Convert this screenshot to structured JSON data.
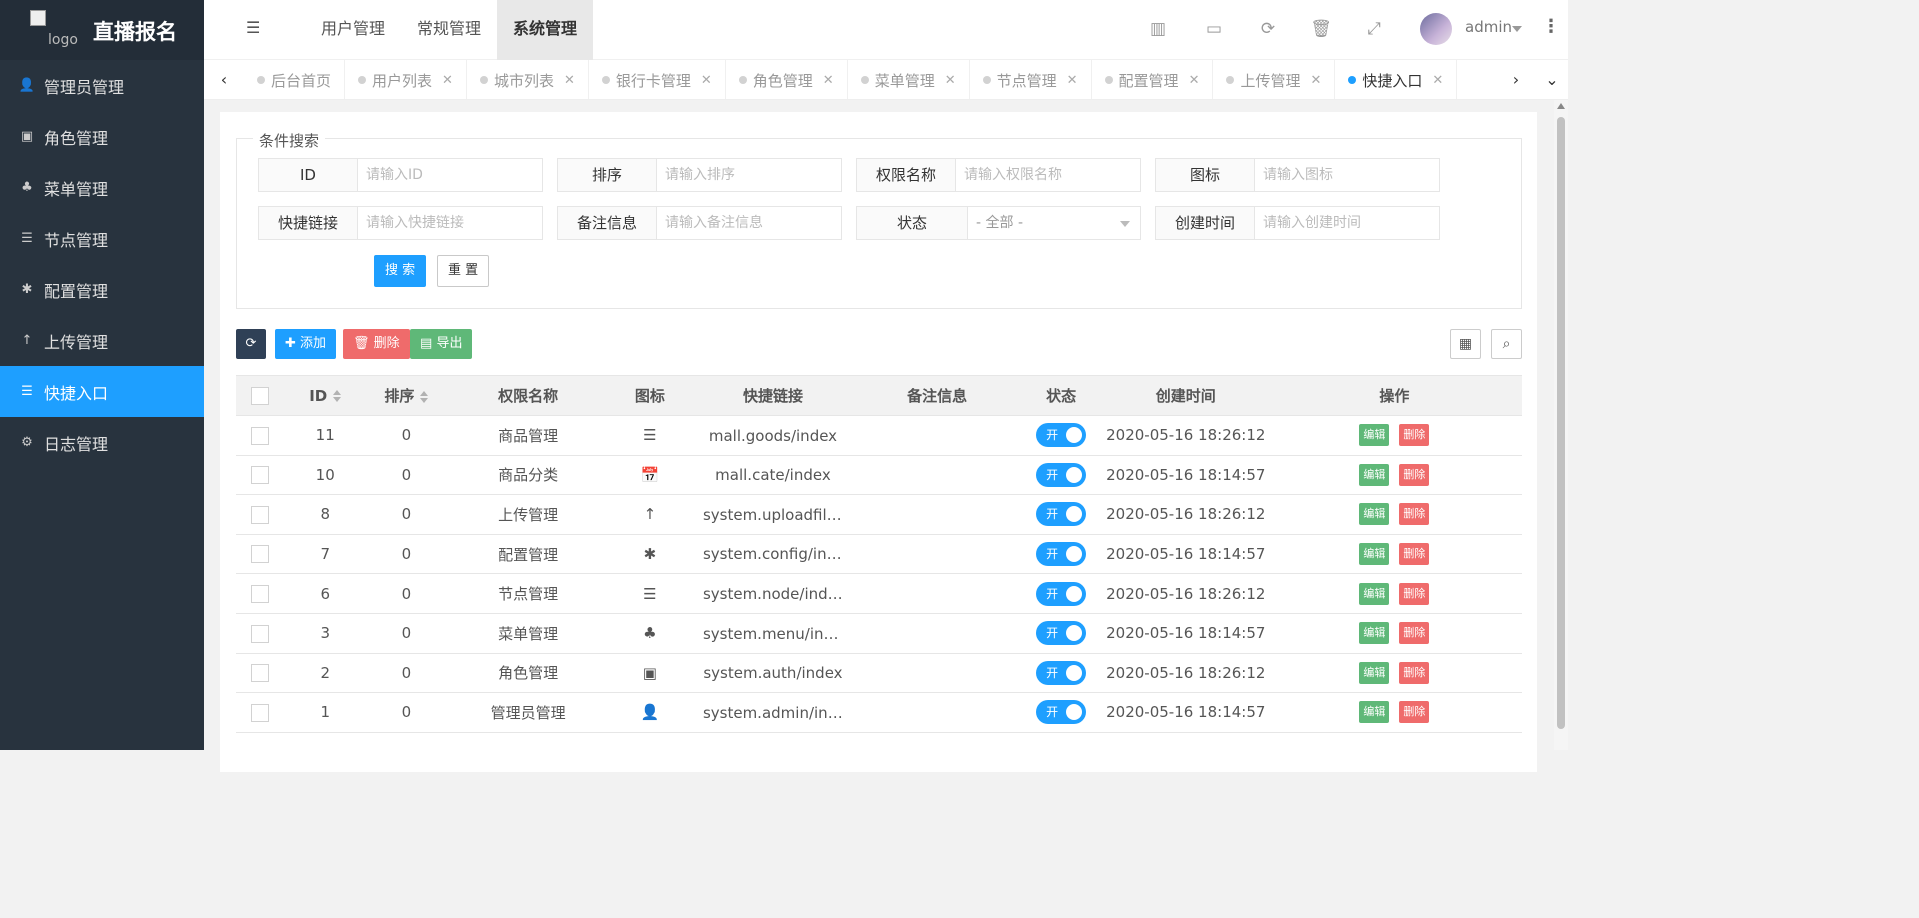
{
  "app": {
    "logo_alt": "logo",
    "title": "直播报名"
  },
  "sidebar": {
    "items": [
      {
        "label": "管理员管理",
        "icon": "user-icon",
        "glyph": "👤"
      },
      {
        "label": "角色管理",
        "icon": "id-badge-icon",
        "glyph": "▣"
      },
      {
        "label": "菜单管理",
        "icon": "tree-icon",
        "glyph": "♣"
      },
      {
        "label": "节点管理",
        "icon": "list-icon",
        "glyph": "☰"
      },
      {
        "label": "配置管理",
        "icon": "asterisk-icon",
        "glyph": "✱"
      },
      {
        "label": "上传管理",
        "icon": "arrow-up-icon",
        "glyph": "↑"
      },
      {
        "label": "快捷入口",
        "icon": "list-icon",
        "glyph": "☰"
      },
      {
        "label": "日志管理",
        "icon": "gear-icon",
        "glyph": "⚙"
      }
    ],
    "active_index": 6
  },
  "header": {
    "nav": [
      "用户管理",
      "常规管理",
      "系统管理"
    ],
    "active_nav": 2,
    "user": "admin"
  },
  "tabs": [
    {
      "label": "后台首页",
      "closable": false
    },
    {
      "label": "用户列表",
      "closable": true
    },
    {
      "label": "城市列表",
      "closable": true
    },
    {
      "label": "银行卡管理",
      "closable": true
    },
    {
      "label": "角色管理",
      "closable": true
    },
    {
      "label": "菜单管理",
      "closable": true
    },
    {
      "label": "节点管理",
      "closable": true
    },
    {
      "label": "配置管理",
      "closable": true
    },
    {
      "label": "上传管理",
      "closable": true
    },
    {
      "label": "快捷入口",
      "closable": true,
      "active": true
    }
  ],
  "search": {
    "legend": "条件搜索",
    "fields": [
      {
        "label": "ID",
        "placeholder": "请输入ID"
      },
      {
        "label": "排序",
        "placeholder": "请输入排序"
      },
      {
        "label": "权限名称",
        "placeholder": "请输入权限名称"
      },
      {
        "label": "图标",
        "placeholder": "请输入图标"
      },
      {
        "label": "快捷链接",
        "placeholder": "请输入快捷链接"
      },
      {
        "label": "备注信息",
        "placeholder": "请输入备注信息"
      },
      {
        "label": "状态",
        "select_value": "- 全部 -"
      },
      {
        "label": "创建时间",
        "placeholder": "请输入创建时间"
      }
    ],
    "search_btn": "搜 索",
    "reset_btn": "重 置"
  },
  "toolbar": {
    "add": "添加",
    "delete": "删除",
    "export": "导出"
  },
  "table": {
    "headers": [
      "ID",
      "排序",
      "权限名称",
      "图标",
      "快捷链接",
      "备注信息",
      "状态",
      "创建时间",
      "操作"
    ],
    "rows": [
      {
        "id": "11",
        "sort": "0",
        "name": "商品管理",
        "icon": "list-icon",
        "glyph": "☰",
        "link": "mall.goods/index",
        "remark": "",
        "status": "开",
        "created": "2020-05-16 18:26:12"
      },
      {
        "id": "10",
        "sort": "0",
        "name": "商品分类",
        "icon": "calendar-check-icon",
        "glyph": "📅",
        "link": "mall.cate/index",
        "remark": "",
        "status": "开",
        "created": "2020-05-16 18:14:57"
      },
      {
        "id": "8",
        "sort": "0",
        "name": "上传管理",
        "icon": "arrow-up-icon",
        "glyph": "↑",
        "link": "system.uploadfile/i…",
        "remark": "",
        "status": "开",
        "created": "2020-05-16 18:26:12"
      },
      {
        "id": "7",
        "sort": "0",
        "name": "配置管理",
        "icon": "asterisk-icon",
        "glyph": "✱",
        "link": "system.config/index",
        "remark": "",
        "status": "开",
        "created": "2020-05-16 18:14:57"
      },
      {
        "id": "6",
        "sort": "0",
        "name": "节点管理",
        "icon": "list-icon",
        "glyph": "☰",
        "link": "system.node/index",
        "remark": "",
        "status": "开",
        "created": "2020-05-16 18:26:12"
      },
      {
        "id": "3",
        "sort": "0",
        "name": "菜单管理",
        "icon": "tree-icon",
        "glyph": "♣",
        "link": "system.menu/index",
        "remark": "",
        "status": "开",
        "created": "2020-05-16 18:14:57"
      },
      {
        "id": "2",
        "sort": "0",
        "name": "角色管理",
        "icon": "id-badge-icon",
        "glyph": "▣",
        "link": "system.auth/index",
        "remark": "",
        "status": "开",
        "created": "2020-05-16 18:26:12"
      },
      {
        "id": "1",
        "sort": "0",
        "name": "管理员管理",
        "icon": "user-icon",
        "glyph": "👤",
        "link": "system.admin/index",
        "remark": "",
        "status": "开",
        "created": "2020-05-16 18:14:57"
      }
    ],
    "edit_label": "编辑",
    "delete_label": "删除"
  }
}
